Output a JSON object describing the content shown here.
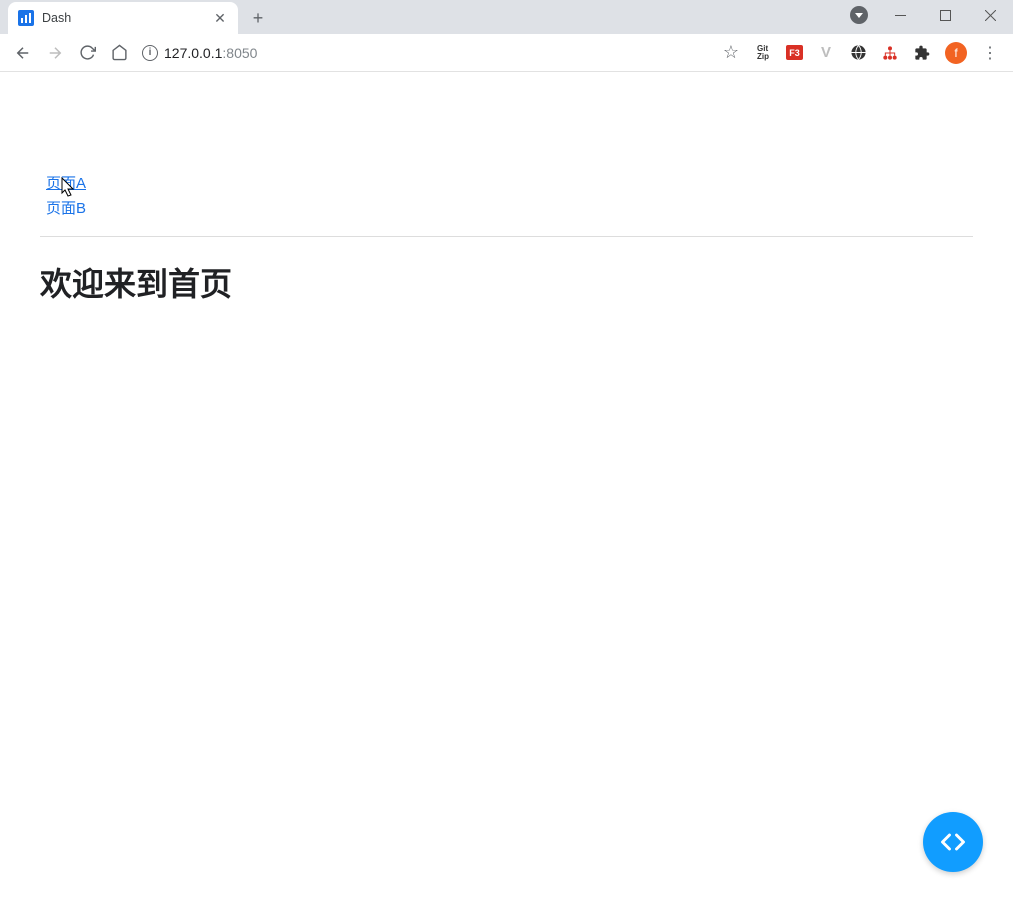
{
  "browser": {
    "tab_title": "Dash",
    "url_host": "127.0.0.1",
    "url_port": ":8050",
    "avatar_letter": "f",
    "gitzip_label": "Git\nZip",
    "f3_label": "F3",
    "v_label": "V"
  },
  "page": {
    "links": [
      {
        "label": "页面A"
      },
      {
        "label": "页面B"
      }
    ],
    "heading": "欢迎来到首页"
  }
}
